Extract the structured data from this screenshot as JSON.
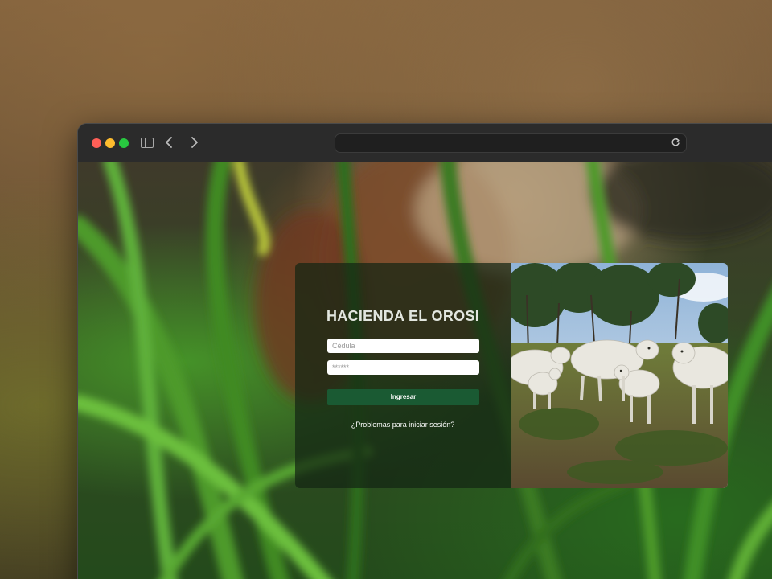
{
  "browser": {
    "address": "",
    "icons": {
      "sidebar": "sidebar-icon",
      "back": "chevron-left-icon",
      "forward": "chevron-right-icon",
      "reload": "reload-icon"
    }
  },
  "login": {
    "title": "HACIENDA EL OROSI",
    "cedula_placeholder": "Cédula",
    "password_placeholder": "******",
    "submit_label": "Ingresar",
    "help_link": "¿Problemas para iniciar sesión?"
  },
  "colors": {
    "submit_button": "#1a5a33",
    "panel_bg": "rgba(20,38,20,0.72)",
    "title": "#e2e6df"
  }
}
